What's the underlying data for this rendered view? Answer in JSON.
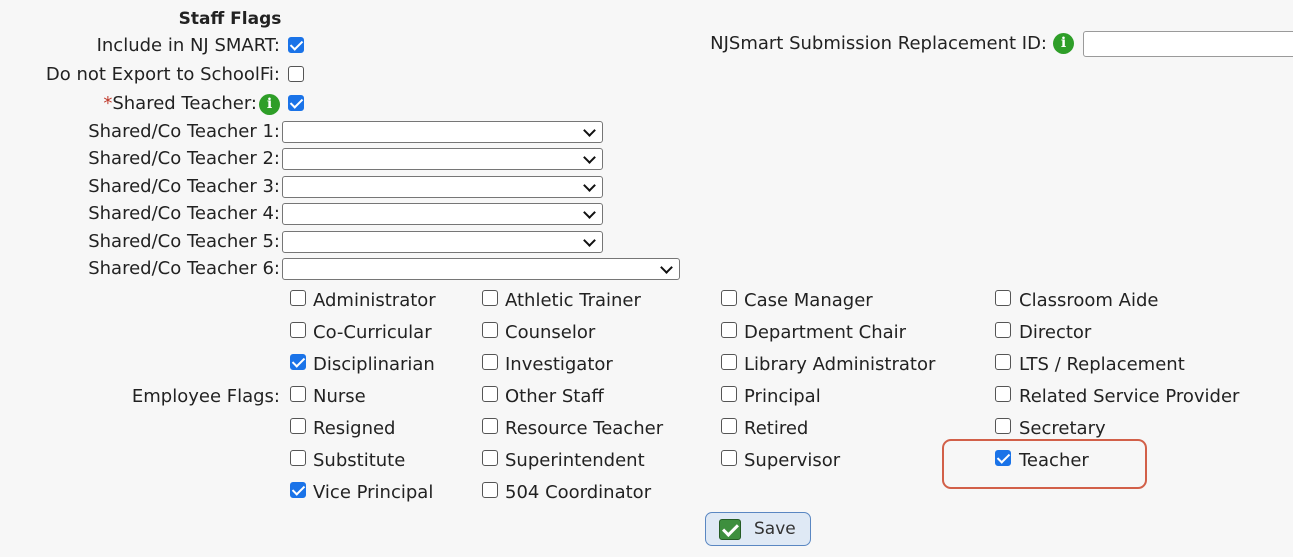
{
  "staff_flags": {
    "title": "Staff Flags",
    "include_nj_smart": {
      "label": "Include in NJ SMART:",
      "checked": true
    },
    "do_not_export": {
      "label": "Do not Export to SchoolFi:",
      "checked": false
    },
    "shared_teacher": {
      "required_mark": "*",
      "label": "Shared Teacher:",
      "checked": true
    },
    "co_teachers": [
      {
        "label": "Shared/Co Teacher 1:",
        "value": ""
      },
      {
        "label": "Shared/Co Teacher 2:",
        "value": ""
      },
      {
        "label": "Shared/Co Teacher 3:",
        "value": ""
      },
      {
        "label": "Shared/Co Teacher 4:",
        "value": ""
      },
      {
        "label": "Shared/Co Teacher 5:",
        "value": ""
      },
      {
        "label": "Shared/Co Teacher 6:",
        "value": ""
      }
    ],
    "replacement_id": {
      "label": "NJSmart Submission Replacement ID:",
      "value": ""
    }
  },
  "employee_flags": {
    "label": "Employee Flags:",
    "flags": [
      {
        "label": "Administrator",
        "checked": false
      },
      {
        "label": "Athletic Trainer",
        "checked": false
      },
      {
        "label": "Case Manager",
        "checked": false
      },
      {
        "label": "Classroom Aide",
        "checked": false
      },
      {
        "label": "Co-Curricular",
        "checked": false
      },
      {
        "label": "Counselor",
        "checked": false
      },
      {
        "label": "Department Chair",
        "checked": false
      },
      {
        "label": "Director",
        "checked": false
      },
      {
        "label": "Disciplinarian",
        "checked": true
      },
      {
        "label": "Investigator",
        "checked": false
      },
      {
        "label": "Library Administrator",
        "checked": false
      },
      {
        "label": "LTS / Replacement",
        "checked": false
      },
      {
        "label": "Nurse",
        "checked": false
      },
      {
        "label": "Other Staff",
        "checked": false
      },
      {
        "label": "Principal",
        "checked": false
      },
      {
        "label": "Related Service Provider",
        "checked": false
      },
      {
        "label": "Resigned",
        "checked": false
      },
      {
        "label": "Resource Teacher",
        "checked": false
      },
      {
        "label": "Retired",
        "checked": false
      },
      {
        "label": "Secretary",
        "checked": false
      },
      {
        "label": "Substitute",
        "checked": false
      },
      {
        "label": "Superintendent",
        "checked": false
      },
      {
        "label": "Supervisor",
        "checked": false
      },
      {
        "label": "Teacher",
        "checked": true
      },
      {
        "label": "Vice Principal",
        "checked": true
      },
      {
        "label": "504 Coordinator",
        "checked": false
      }
    ]
  },
  "actions": {
    "save_label": "Save"
  },
  "icons": {
    "info": "info-icon",
    "save": "check-icon"
  },
  "colors": {
    "info_green": "#2e9e28",
    "checkbox_blue": "#1a73e8",
    "highlight": "#d26049",
    "save_green": "#3e8f3e"
  }
}
